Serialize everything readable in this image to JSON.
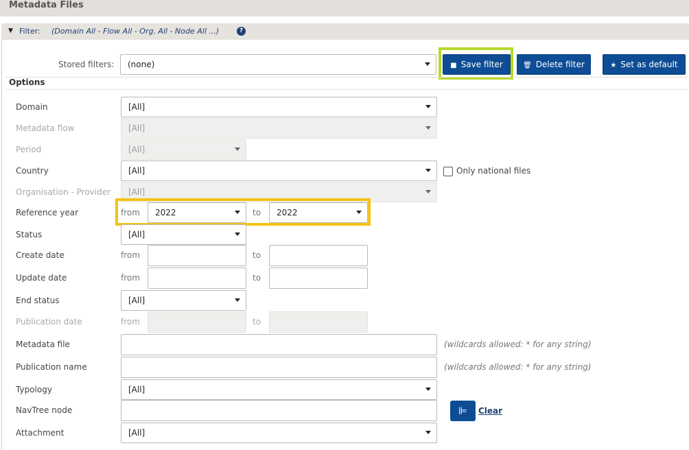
{
  "page": {
    "title": "Metadata Files"
  },
  "filter": {
    "label": "Filter:",
    "summary": "(Domain All - Flow All - Org. All - Node All ...)",
    "help": "?"
  },
  "stored_filters": {
    "label": "Stored filters:",
    "value": "(none)",
    "save_label": "Save filter",
    "delete_label": "Delete filter",
    "default_label": "Set as default"
  },
  "options": {
    "title": "Options",
    "domain": {
      "label": "Domain",
      "value": "[All]"
    },
    "metadata_flow": {
      "label": "Metadata flow",
      "value": "[All]"
    },
    "period": {
      "label": "Period",
      "value": "[All]"
    },
    "country": {
      "label": "Country",
      "value": "[All]",
      "national_label": "Only national files"
    },
    "organisation": {
      "label": "Organisation - Provider",
      "value": "[All]"
    },
    "reference_year": {
      "label": "Reference year",
      "from_label": "from",
      "from_value": "2022",
      "to_label": "to",
      "to_value": "2022"
    },
    "status": {
      "label": "Status",
      "value": "[All]"
    },
    "create_date": {
      "label": "Create date",
      "from_label": "from",
      "to_label": "to"
    },
    "update_date": {
      "label": "Update date",
      "from_label": "from",
      "to_label": "to"
    },
    "end_status": {
      "label": "End status",
      "value": "[All]"
    },
    "publication_date": {
      "label": "Publication date",
      "from_label": "from",
      "to_label": "to"
    },
    "metadata_file": {
      "label": "Metadata file",
      "hint": "(wildcards allowed: * for any string)"
    },
    "publication_name": {
      "label": "Publication name",
      "hint": "(wildcards allowed: * for any string)"
    },
    "typology": {
      "label": "Typology",
      "value": "[All]"
    },
    "navtree": {
      "label": "NavTree node",
      "clear_label": "Clear"
    },
    "attachment": {
      "label": "Attachment",
      "value": "[All]"
    }
  }
}
